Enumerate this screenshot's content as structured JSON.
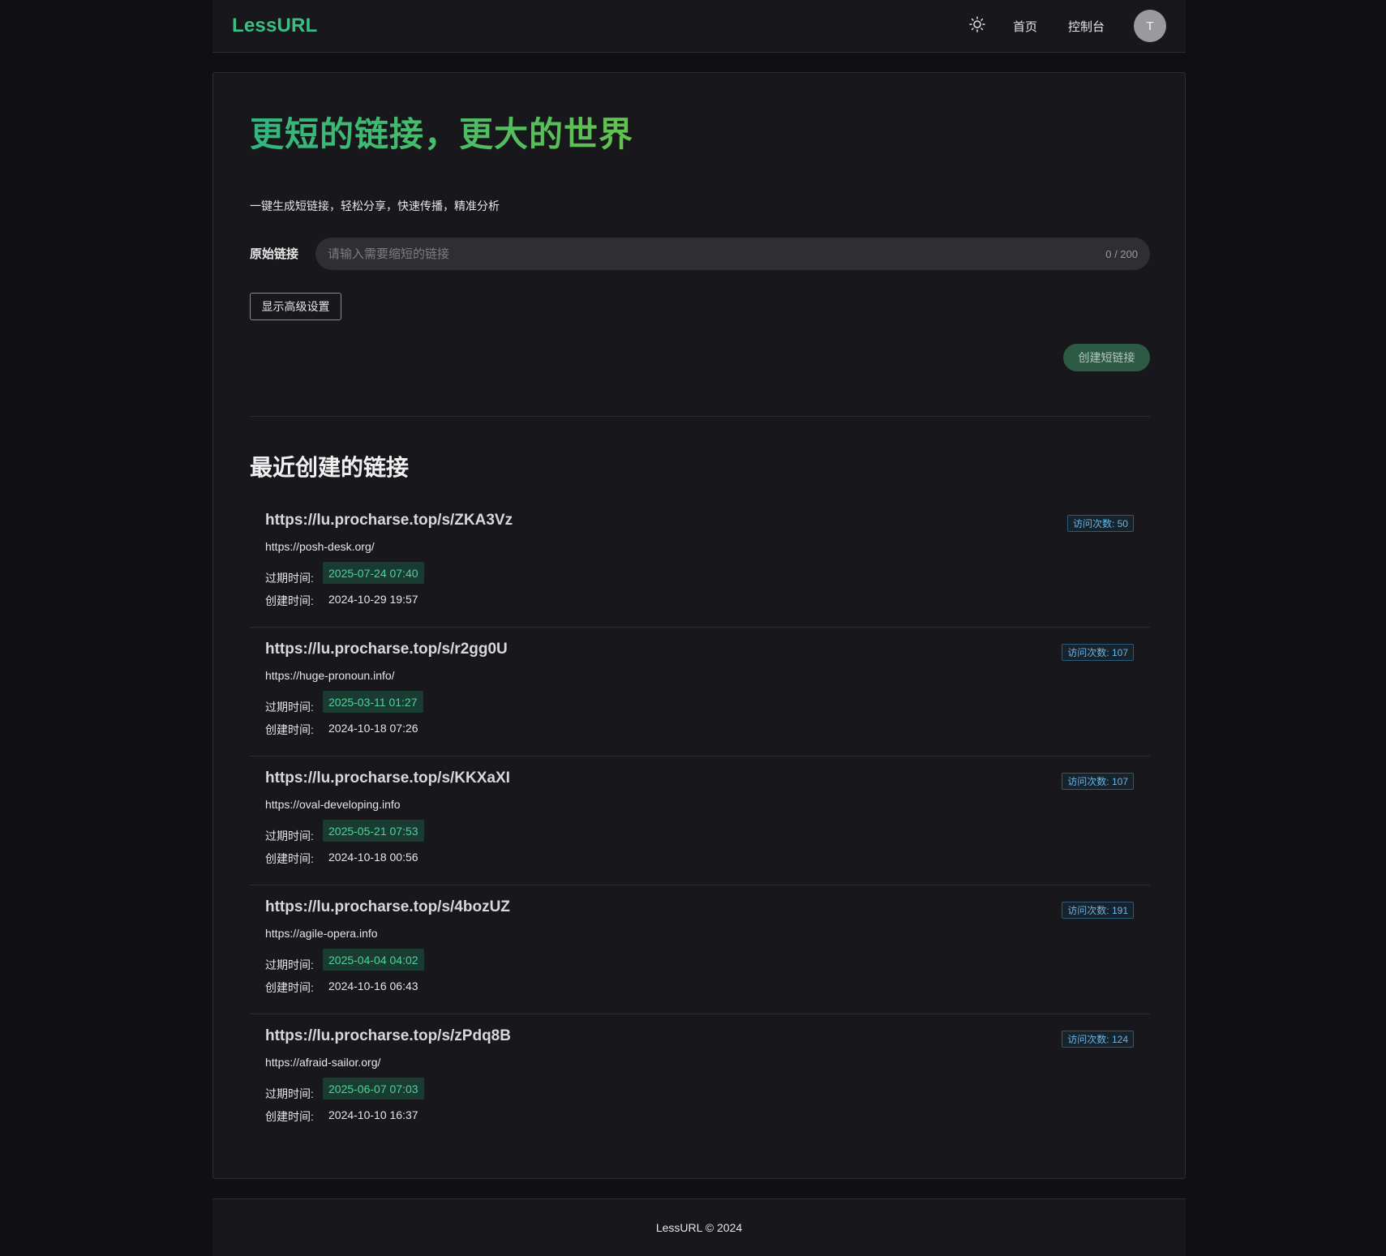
{
  "header": {
    "logo": "LessURL",
    "theme_icon": "sun-icon",
    "nav_home": "首页",
    "nav_dashboard": "控制台",
    "avatar_initial": "T"
  },
  "hero": {
    "title": "更短的链接，更大的世界",
    "subtitle": "一键生成短链接，轻松分享，快速传播，精准分析"
  },
  "form": {
    "label": "原始链接",
    "placeholder": "请输入需要缩短的链接",
    "value": "",
    "char_count": "0 / 200",
    "advanced_button": "显示高级设置",
    "create_button": "创建短链接"
  },
  "recent": {
    "title": "最近创建的链接",
    "expire_label": "过期时间:",
    "created_label": "创建时间:",
    "items": [
      {
        "short_url": "https://lu.procharse.top/s/ZKA3Vz",
        "original_url": "https://posh-desk.org/",
        "visits": "访问次数: 50",
        "expire": "2025-07-24 07:40",
        "created": "2024-10-29 19:57"
      },
      {
        "short_url": "https://lu.procharse.top/s/r2gg0U",
        "original_url": "https://huge-pronoun.info/",
        "visits": "访问次数: 107",
        "expire": "2025-03-11 01:27",
        "created": "2024-10-18 07:26"
      },
      {
        "short_url": "https://lu.procharse.top/s/KKXaXI",
        "original_url": "https://oval-developing.info",
        "visits": "访问次数: 107",
        "expire": "2025-05-21 07:53",
        "created": "2024-10-18 00:56"
      },
      {
        "short_url": "https://lu.procharse.top/s/4bozUZ",
        "original_url": "https://agile-opera.info",
        "visits": "访问次数: 191",
        "expire": "2025-04-04 04:02",
        "created": "2024-10-16 06:43"
      },
      {
        "short_url": "https://lu.procharse.top/s/zPdq8B",
        "original_url": "https://afraid-sailor.org/",
        "visits": "访问次数: 124",
        "expire": "2025-06-07 07:03",
        "created": "2024-10-10 16:37"
      }
    ]
  },
  "footer": {
    "text": "LessURL © 2024"
  },
  "colors": {
    "accent": "#3bbf83",
    "background": "#101014",
    "surface": "#18181c",
    "expire_tag_bg": "#193b32",
    "expire_tag_text": "#4fd39a",
    "visits_text": "#6fb3e0"
  }
}
